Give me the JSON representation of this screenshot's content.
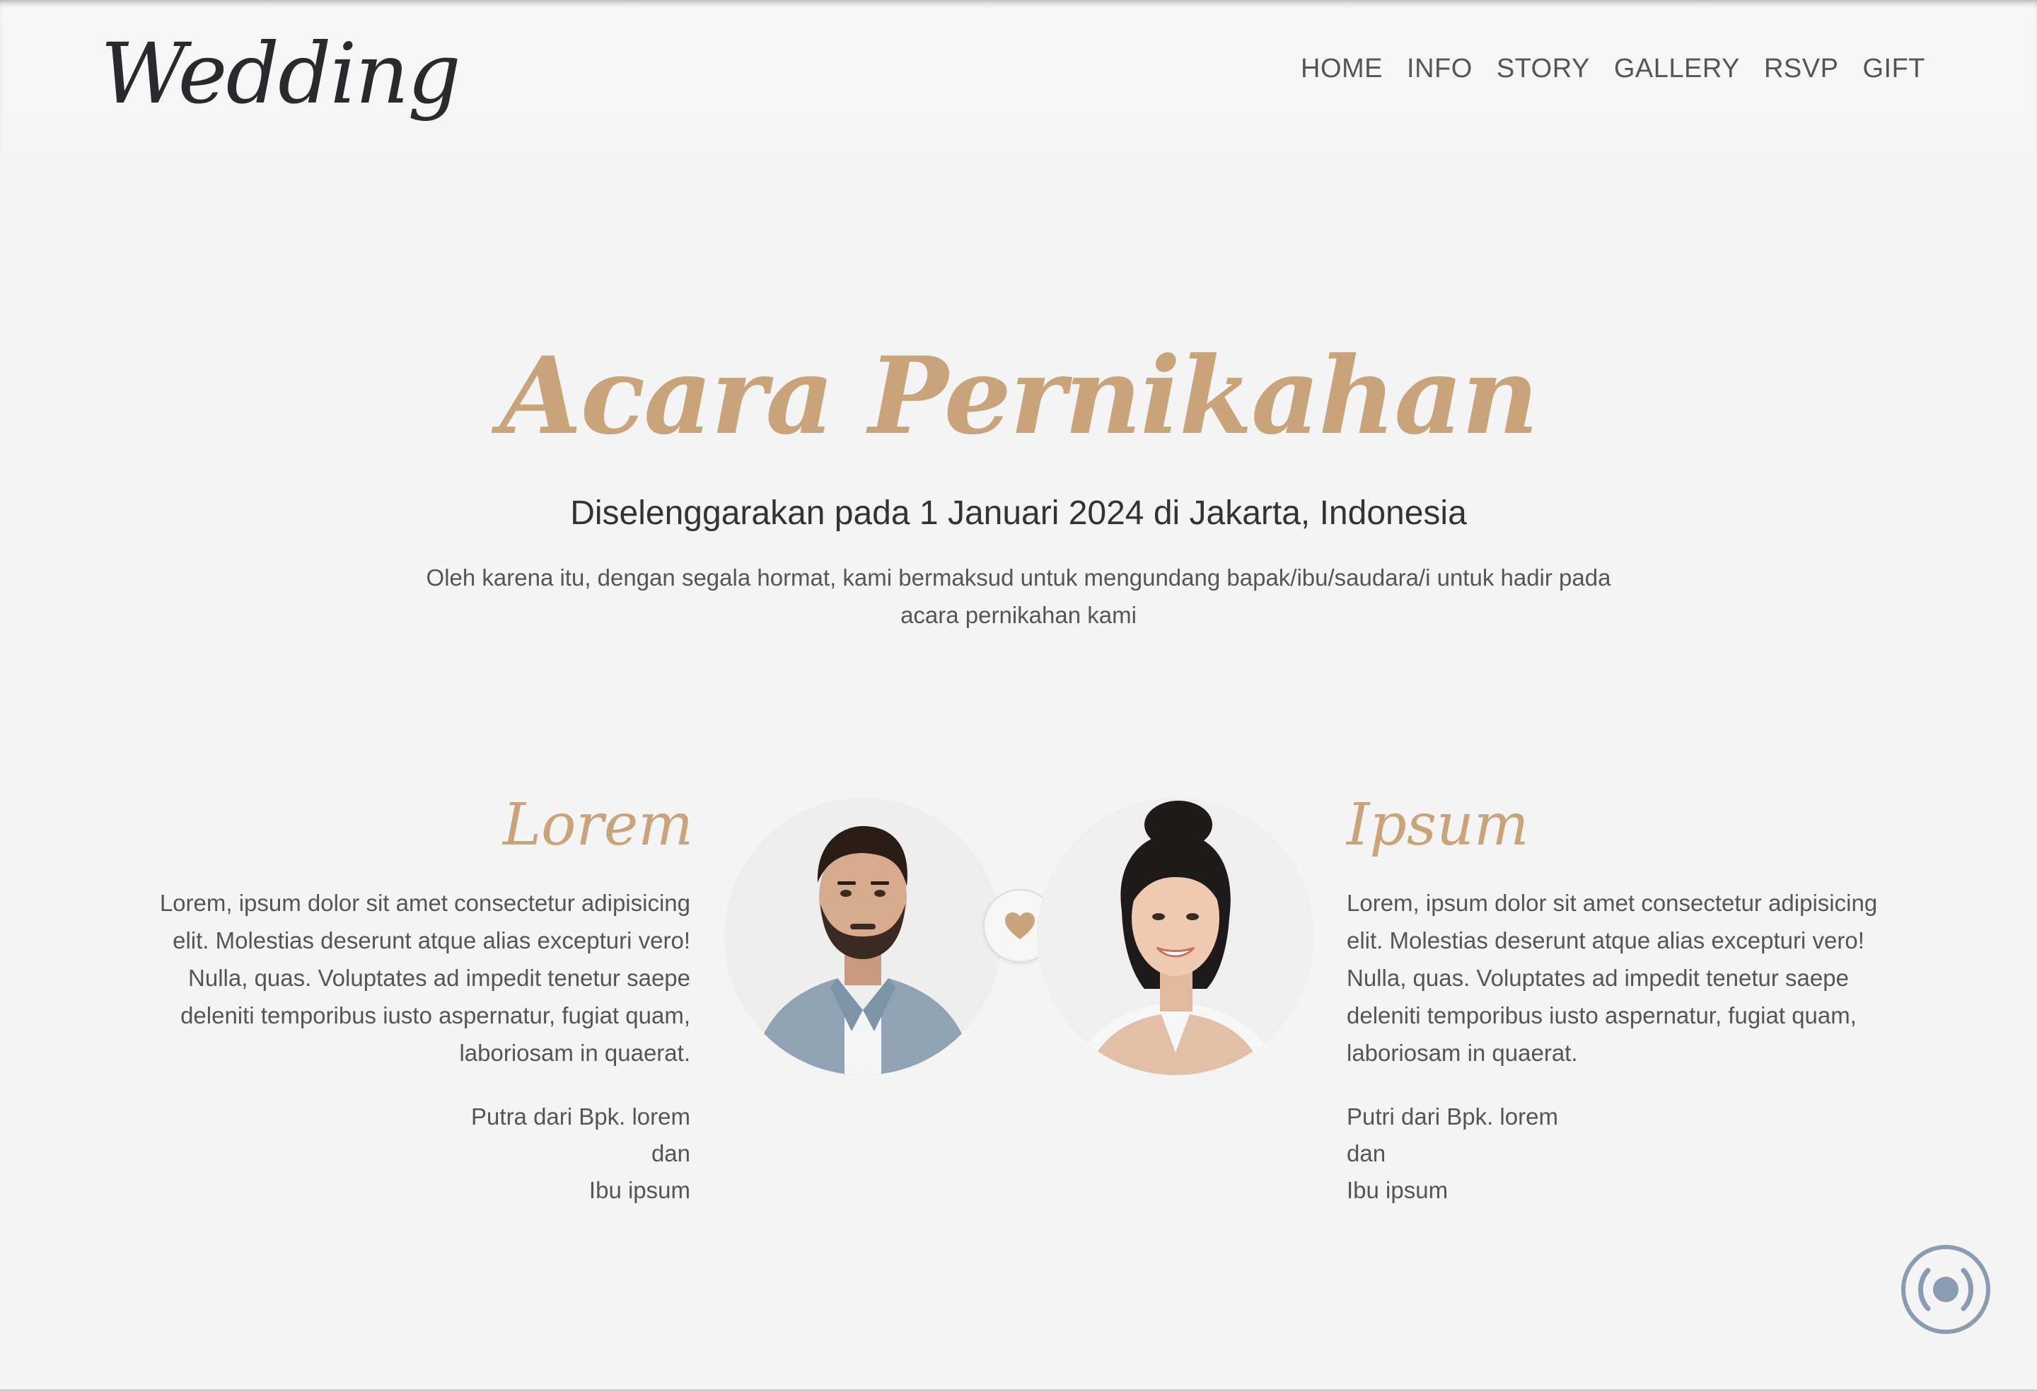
{
  "brand": {
    "logo_text": "Wedding"
  },
  "nav": {
    "items": [
      {
        "label": "HOME"
      },
      {
        "label": "INFO"
      },
      {
        "label": "STORY"
      },
      {
        "label": "GALLERY"
      },
      {
        "label": "RSVP"
      },
      {
        "label": "GIFT"
      }
    ]
  },
  "hero": {
    "title": "Acara Pernikahan",
    "subtitle": "Diselenggarakan pada 1 Januari 2024 di Jakarta, Indonesia",
    "invitation": "Oleh karena itu, dengan segala hormat, kami bermaksud untuk mengundang bapak/ibu/saudara/i untuk hadir pada acara pernikahan kami"
  },
  "groom": {
    "name": "Lorem",
    "bio": "Lorem, ipsum dolor sit amet consectetur adipisicing elit. Molestias deserunt atque alias excepturi vero! Nulla, quas. Voluptates ad impedit tenetur saepe deleniti temporibus iusto aspernatur, fugiat quam, laboriosam in quaerat.",
    "parents_line1": "Putra dari Bpk. lorem",
    "parents_line2": "dan",
    "parents_line3": "Ibu ipsum"
  },
  "bride": {
    "name": "Ipsum",
    "bio": "Lorem, ipsum dolor sit amet consectetur adipisicing elit. Molestias deserunt atque alias excepturi vero! Nulla, quas. Voluptates ad impedit tenetur saepe deleniti temporibus iusto aspernatur, fugiat quam, laboriosam in quaerat.",
    "parents_line1": "Putri dari Bpk. lorem",
    "parents_line2": "dan",
    "parents_line3": "Ibu ipsum"
  },
  "icons": {
    "heart": "heart-icon",
    "music": "music-toggle-icon"
  },
  "colors": {
    "accent": "#c9a47a",
    "text": "#555555",
    "heading": "#333333",
    "background": "#f4f4f4",
    "music_button": "#8a9bb2"
  }
}
